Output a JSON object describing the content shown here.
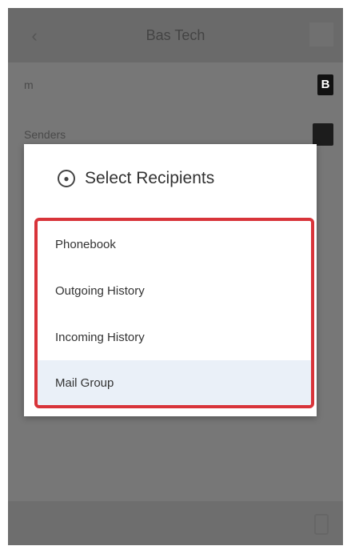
{
  "header": {
    "title": "Bas Tech"
  },
  "rows": [
    {
      "label": "m",
      "icon": "battery-icon",
      "icon_text": "B"
    },
    {
      "label": "Senders",
      "icon": "image-icon"
    }
  ],
  "dialog": {
    "title": "Select Recipients",
    "icon": "recipient-icon",
    "options": [
      "Phonebook",
      "Outgoing History",
      "Incoming History",
      "Mail Group"
    ]
  },
  "colors": {
    "highlight_border": "#d8343a",
    "selected_bg": "#eaf0f8"
  }
}
